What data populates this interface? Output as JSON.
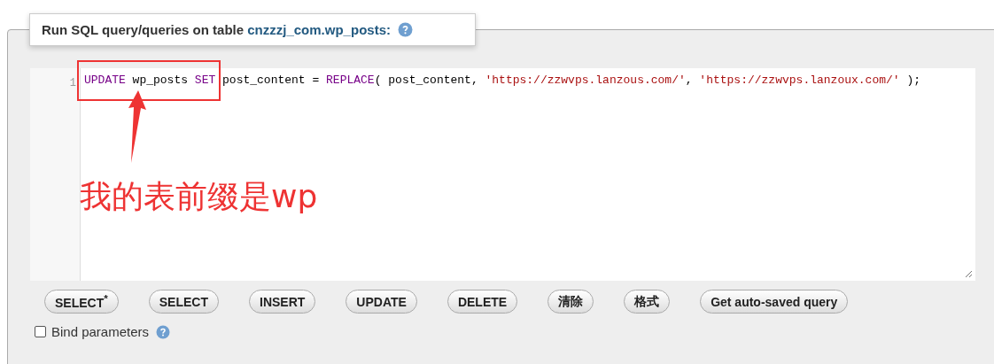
{
  "legend": {
    "title": "Run SQL query/queries on table",
    "table": "cnzzzj_com.wp_posts:"
  },
  "editor": {
    "line_number": "1",
    "tokens": [
      {
        "text": "UPDATE",
        "kind": "keyword"
      },
      {
        "text": " wp_posts ",
        "kind": "plain"
      },
      {
        "text": "SET",
        "kind": "keyword"
      },
      {
        "text": " post_content = ",
        "kind": "plain"
      },
      {
        "text": "REPLACE",
        "kind": "keyword"
      },
      {
        "text": "( post_content, ",
        "kind": "plain"
      },
      {
        "text": "'https://zzwvps.lanzous.com/'",
        "kind": "string"
      },
      {
        "text": ", ",
        "kind": "plain"
      },
      {
        "text": "'https://zzwvps.lanzoux.com/'",
        "kind": "string"
      },
      {
        "text": " );",
        "kind": "plain"
      }
    ]
  },
  "annotation": {
    "text": "我的表前缀是wp"
  },
  "buttons": [
    "SELECT$^{*}$",
    "SELECT",
    "INSERT",
    "UPDATE",
    "DELETE",
    "清除",
    "格式",
    "Get auto-saved query"
  ],
  "bind_parameters": {
    "label": "Bind parameters",
    "checked": false
  }
}
